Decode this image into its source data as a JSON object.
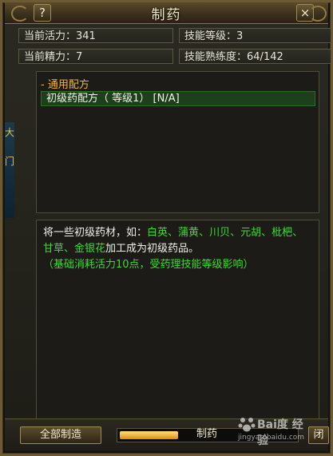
{
  "window": {
    "title": "制药"
  },
  "titlebar": {
    "help_label": "?",
    "close_label": "×"
  },
  "stats": {
    "vitality": {
      "label": "当前活力：",
      "value": "341"
    },
    "skill_level": {
      "label": "技能等级：",
      "value": "3"
    },
    "energy": {
      "label": "当前精力：",
      "value": "7"
    },
    "proficiency": {
      "label": "技能熟练度：",
      "value": "64/142"
    }
  },
  "recipes": {
    "category_label": "- 通用配方",
    "items": [
      {
        "label": "初级药配方（ 等级1） [N/A]"
      }
    ]
  },
  "description": {
    "intro": "将一些初级药材，如：",
    "herbs": [
      "白英",
      "蒲黄",
      "川贝",
      "元胡",
      "枇杷",
      "甘草",
      "金银花"
    ],
    "sep": "、",
    "outro": "加工成为初级药品。",
    "note": "（基础消耗活力10点，受药理技能等级影响）"
  },
  "left_strip": {
    "chars": [
      "大",
      "门"
    ]
  },
  "bottom": {
    "make_all_label": "全部制造",
    "make_label": "制药",
    "close_label": "闭",
    "progress": 0.33
  },
  "watermark": {
    "text": "Bai度 经验",
    "url": "jingyan.baidu.com"
  },
  "colors": {
    "accent_green": "#3bdc2c",
    "header_gold": "#f0b43a",
    "border_gold": "#a08a55"
  }
}
